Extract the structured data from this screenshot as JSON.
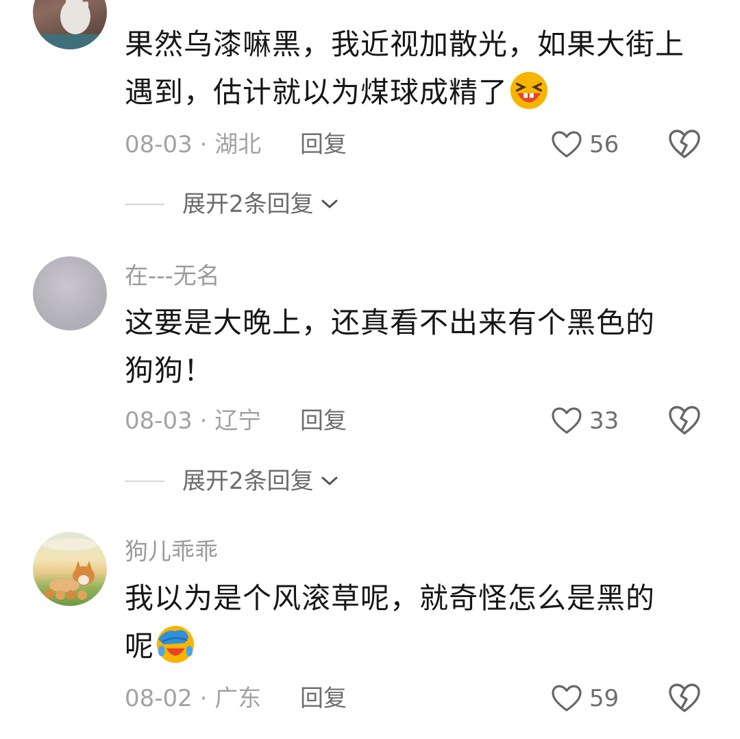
{
  "comments": [
    {
      "username": "",
      "text": "果然乌漆嘛黑，我近视加散光，如果大街上遇到，估计就以为煤球成精了",
      "emoji": "grinning-squint-emoji",
      "date": "08-03",
      "location": "湖北",
      "reply_label": "回复",
      "likes": "56",
      "expand_label": "展开2条回复"
    },
    {
      "username": "在---无名",
      "text_line1": "这要是大晚上，还真看不出来有个黑色的",
      "text_line2": "狗狗！",
      "date": "08-03",
      "location": "辽宁",
      "reply_label": "回复",
      "likes": "33",
      "expand_label": "展开2条回复"
    },
    {
      "username": "狗儿乖乖",
      "text_line1": "我以为是个风滚草呢，就奇怪怎么是黑的",
      "text_line2": "呢",
      "emoji": "facepalm-laugh-emoji",
      "date": "08-02",
      "location": "广东",
      "reply_label": "回复",
      "likes": "59"
    }
  ],
  "meta_separator": " · ",
  "colors": {
    "meta_text": "#a2a2a2",
    "icon_stroke": "#666666",
    "emoji_face": "#f7b500",
    "emoji_mouth": "#e8442c"
  }
}
